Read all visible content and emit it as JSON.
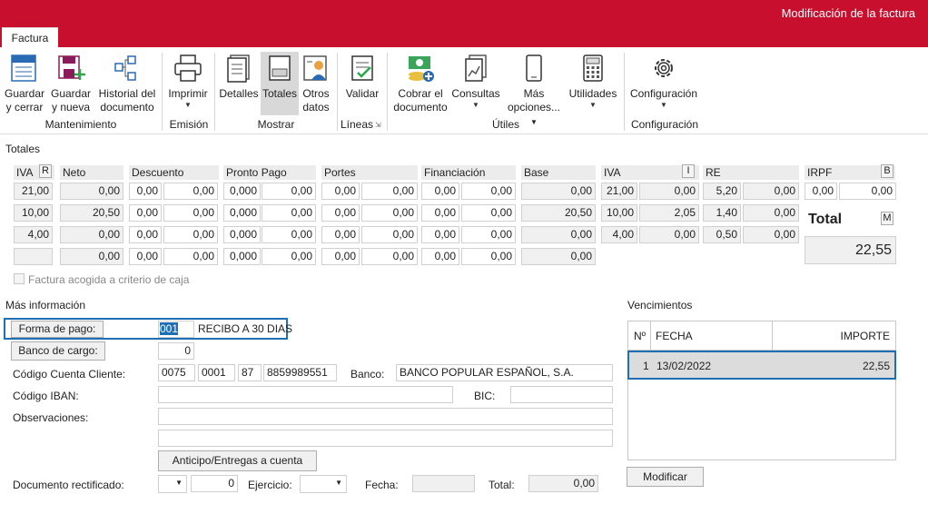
{
  "window": {
    "title": "Modificación de la factura",
    "tab": "Factura"
  },
  "ribbon": {
    "guardar_cerrar": [
      "Guardar",
      "y cerrar"
    ],
    "guardar_nueva": [
      "Guardar",
      "y nueva"
    ],
    "historial": [
      "Historial del",
      "documento"
    ],
    "imprimir": "Imprimir",
    "detalles": "Detalles",
    "totales": "Totales",
    "otros_datos": [
      "Otros",
      "datos"
    ],
    "validar": "Validar",
    "cobrar": [
      "Cobrar el",
      "documento"
    ],
    "consultas": "Consultas",
    "mas_opciones": [
      "Más",
      "opciones..."
    ],
    "utilidades": "Utilidades",
    "configuracion": "Configuración",
    "groups": {
      "mantenimiento": "Mantenimiento",
      "emision": "Emisión",
      "mostrar": "Mostrar",
      "lineas": "Líneas",
      "utiles": "Útiles",
      "configuracion": "Configuración"
    }
  },
  "totales": {
    "section_title": "Totales",
    "headers": {
      "iva": "IVA",
      "iva_tag": "R",
      "neto": "Neto",
      "descuento": "Descuento",
      "pronto_pago": "Pronto Pago",
      "portes": "Portes",
      "financiacion": "Financiación",
      "base": "Base",
      "iva2": "IVA",
      "iva2_tag": "I",
      "re": "RE",
      "irpf": "IRPF",
      "irpf_tag": "B"
    },
    "rows": [
      {
        "iva": "21,00",
        "neto": "0,00",
        "d1": "0,00",
        "d2": "0,00",
        "p1": "0,000",
        "p2": "0,00",
        "po1": "0,00",
        "po2": "0,00",
        "f1": "0,00",
        "f2": "0,00",
        "base": "0,00",
        "i1": "21,00",
        "i2": "0,00",
        "r1": "5,20",
        "r2": "0,00"
      },
      {
        "iva": "10,00",
        "neto": "20,50",
        "d1": "0,00",
        "d2": "0,00",
        "p1": "0,000",
        "p2": "0,00",
        "po1": "0,00",
        "po2": "0,00",
        "f1": "0,00",
        "f2": "0,00",
        "base": "20,50",
        "i1": "10,00",
        "i2": "2,05",
        "r1": "1,40",
        "r2": "0,00"
      },
      {
        "iva": "4,00",
        "neto": "0,00",
        "d1": "0,00",
        "d2": "0,00",
        "p1": "0,000",
        "p2": "0,00",
        "po1": "0,00",
        "po2": "0,00",
        "f1": "0,00",
        "f2": "0,00",
        "base": "0,00",
        "i1": "4,00",
        "i2": "0,00",
        "r1": "0,50",
        "r2": "0,00"
      },
      {
        "iva": "",
        "neto": "0,00",
        "d1": "0,00",
        "d2": "0,00",
        "p1": "0,000",
        "p2": "0,00",
        "po1": "0,00",
        "po2": "0,00",
        "f1": "0,00",
        "f2": "0,00",
        "base": "0,00"
      }
    ],
    "irpf1": "0,00",
    "irpf2": "0,00",
    "total_label": "Total",
    "total_tag": "M",
    "total_value": "22,55",
    "caja_label": "Factura acogida a criterio de caja"
  },
  "mas_info": {
    "title": "Más información",
    "forma_pago_label": "Forma de pago:",
    "forma_pago_code": "001",
    "forma_pago_desc": "RECIBO A 30 DIAS",
    "banco_cargo_label": "Banco de cargo:",
    "banco_cargo_value": "0",
    "ccc_label": "Código Cuenta Cliente:",
    "ccc": [
      "0075",
      "0001",
      "87",
      "8859989551"
    ],
    "banco_label": "Banco:",
    "banco_value": "BANCO POPULAR ESPAÑOL, S.A.",
    "iban_label": "Código IBAN:",
    "bic_label": "BIC:",
    "obs_label": "Observaciones:",
    "anticipo_button": "Anticipo/Entregas a cuenta",
    "doc_rect_label": "Documento rectificado:",
    "doc_rect_value": "0",
    "ejercicio_label": "Ejercicio:",
    "fecha_label": "Fecha:",
    "total_label": "Total:",
    "total_value": "0,00"
  },
  "vencimientos": {
    "title": "Vencimientos",
    "headers": {
      "n": "Nº",
      "fecha": "FECHA",
      "importe": "IMPORTE"
    },
    "rows": [
      {
        "n": "1",
        "fecha": "13/02/2022",
        "importe": "22,55"
      }
    ],
    "modificar_button": "Modificar"
  },
  "colors": {
    "accent": "#c8102e",
    "selection": "#1f6fb5"
  }
}
